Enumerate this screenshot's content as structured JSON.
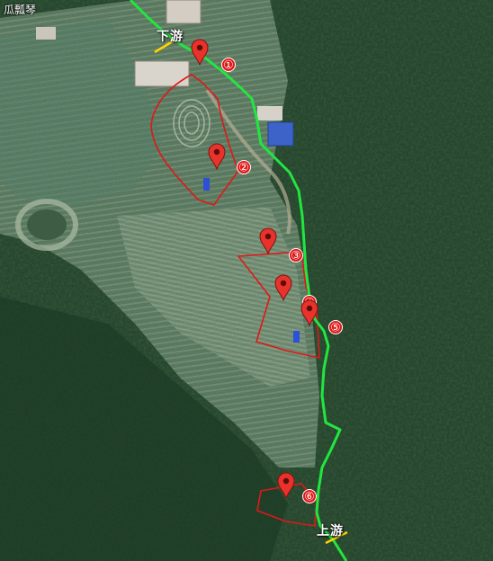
{
  "map": {
    "corner_label": "瓜瓢琴",
    "colors": {
      "stream": "#22e640",
      "boundary": "#e01818",
      "marker": "#e8322b",
      "marker_badge_text": "#ffffff",
      "flow_arrow": "#ffd400",
      "label_text": "#ffffff"
    },
    "flow_labels": {
      "downstream": "下游",
      "upstream": "上游"
    },
    "markers": [
      {
        "id": 1,
        "label": "①"
      },
      {
        "id": 2,
        "label": "②"
      },
      {
        "id": 3,
        "label": "③"
      },
      {
        "id": 4,
        "label": "④"
      },
      {
        "id": 5,
        "label": "⑤"
      },
      {
        "id": 6,
        "label": "⑥"
      }
    ]
  }
}
